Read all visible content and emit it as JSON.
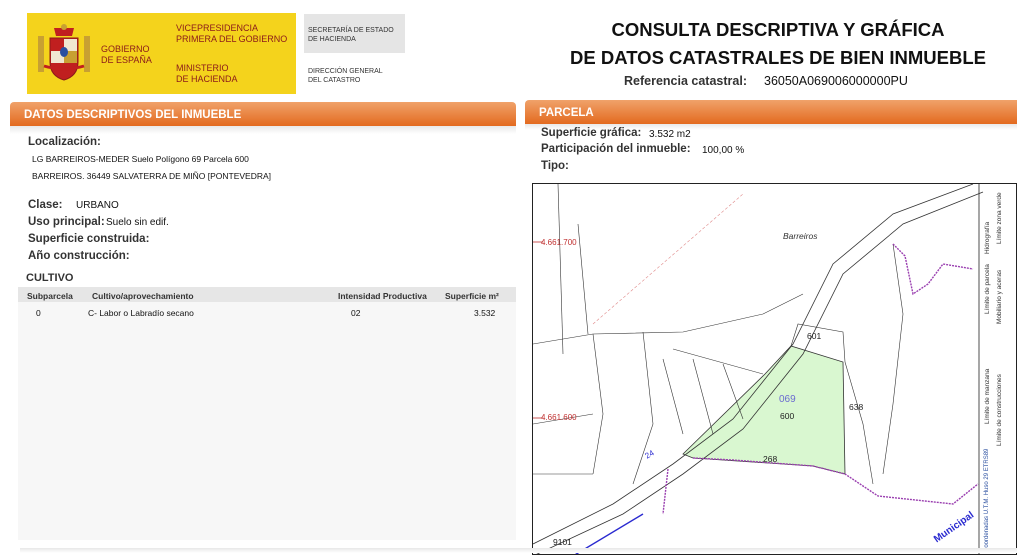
{
  "header": {
    "gobierno": "GOBIERNO\nDE ESPAÑA",
    "vicepresidencia": "VICEPRESIDENCIA\nPRIMERA DEL GOBIERNO",
    "ministerio": "MINISTERIO\nDE HACIENDA",
    "secretaria": "SECRETARÍA DE ESTADO\nDE HACIENDA",
    "direccion": "DIRECCIÓN GENERAL\nDEL CATASTRO",
    "title_line1": "CONSULTA DESCRIPTIVA Y GRÁFICA",
    "title_line2": "DE DATOS CATASTRALES DE BIEN INMUEBLE",
    "ref_label": "Referencia catastral:",
    "ref_value": "36050A069006000000PU"
  },
  "descriptivos": {
    "heading": "DATOS DESCRIPTIVOS DEL INMUEBLE",
    "localizacion_label": "Localización:",
    "localizacion_line1": "LG BARREIROS-MEDER  Suelo Polígono 69 Parcela 600",
    "localizacion_line2": "BARREIROS. 36449 SALVATERRA DE MIÑO [PONTEVEDRA]",
    "clase_label": "Clase:",
    "clase_value": "URBANO",
    "uso_label": "Uso principal:",
    "uso_value": "Suelo sin edif.",
    "superficie_label": "Superficie construida:",
    "anio_label": "Año construcción:"
  },
  "cultivo": {
    "heading": "CULTIVO",
    "columns": [
      "Subparcela",
      "Cultivo/aprovechamiento",
      "Intensidad Productiva",
      "Superficie m²"
    ],
    "rows": [
      [
        "0",
        "C- Labor o Labradío secano",
        "02",
        "3.532"
      ]
    ]
  },
  "parcela": {
    "heading": "PARCELA",
    "superficie_label": "Superficie gráfica:",
    "superficie_value": "3.532 m2",
    "participacion_label": "Participación del inmueble:",
    "participacion_value": "100,00 %",
    "tipo_label": "Tipo:"
  },
  "map": {
    "place_name": "Barreiros",
    "coord_top": "4.661.700",
    "coord_mid": "4.661.600",
    "parcel_ids": [
      "601",
      "069",
      "600",
      "638",
      "268",
      "24",
      "9101"
    ],
    "road_label": "Municipal",
    "highlight_color": "#d9f7d0",
    "legend": [
      "Límite de parcela",
      "Hidrografía",
      "Límite zona verde",
      "Mobiliario y aceras",
      "Límite de manzana",
      "Límite de construcciones",
      "Coordenadas U.T.M. Huso 29 ETRS89"
    ]
  }
}
